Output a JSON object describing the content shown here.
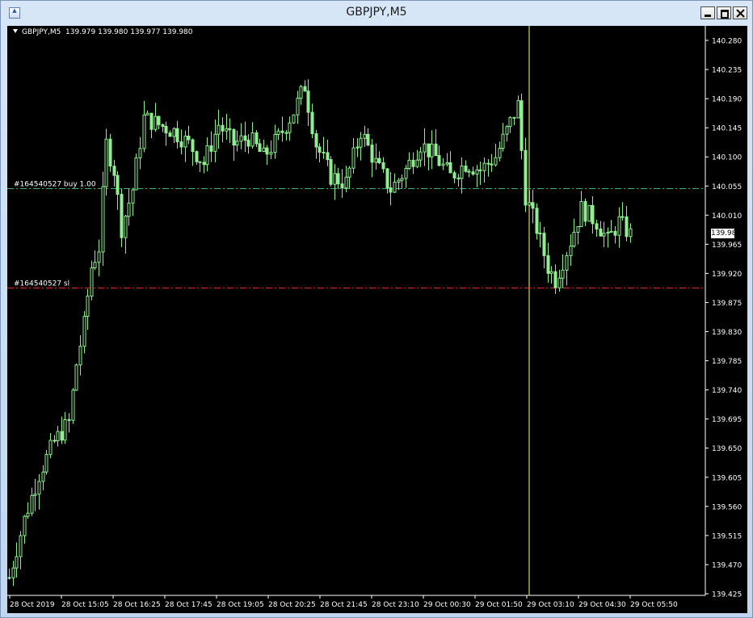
{
  "window": {
    "title": "GBPJPY,M5",
    "icon": "chart-window-icon",
    "controls": [
      "minimize",
      "maximize",
      "close"
    ]
  },
  "colors": {
    "background": "#000000",
    "candle": "#90ee90",
    "buy_line": "#3cb371",
    "sl_line": "#ff2020",
    "cursor_line": "#ffff60",
    "axis": "#ffffff"
  },
  "chart_info": {
    "symbol": "GBPJPY,M5",
    "ohlc": "139.979 139.980 139.977 139.980"
  },
  "current_price": "139.980",
  "order_lines": [
    {
      "label": "#164540527 buy 1.00",
      "price": 140.052,
      "style": "dash-dot",
      "color": "#3cb371"
    },
    {
      "label": "#164540527 sl",
      "price": 139.898,
      "style": "dash-dot",
      "color": "#ff2020"
    }
  ],
  "chart_data": {
    "type": "candlestick",
    "y_ticks": [
      "140.280",
      "140.235",
      "140.190",
      "140.145",
      "140.100",
      "140.055",
      "140.010",
      "139.965",
      "139.920",
      "139.875",
      "139.830",
      "139.785",
      "139.740",
      "139.695",
      "139.650",
      "139.605",
      "139.560",
      "139.515",
      "139.470",
      "139.425"
    ],
    "ylim": [
      139.425,
      140.28
    ],
    "x_ticks": [
      "28 Oct 2019",
      "28 Oct 15:05",
      "28 Oct 16:25",
      "28 Oct 17:45",
      "28 Oct 19:05",
      "28 Oct 20:25",
      "28 Oct 21:45",
      "28 Oct 23:10",
      "29 Oct 00:30",
      "29 Oct 01:50",
      "29 Oct 03:10",
      "29 Oct 04:30",
      "29 Oct 05:50"
    ],
    "cursor_after_label_index": 10,
    "series_shape": [
      [
        0,
        139.45
      ],
      [
        4,
        139.54
      ],
      [
        8,
        139.61
      ],
      [
        12,
        139.66
      ],
      [
        16,
        139.69
      ],
      [
        18,
        139.78
      ],
      [
        20,
        139.84
      ],
      [
        22,
        139.93
      ],
      [
        24,
        139.96
      ],
      [
        26,
        140.12
      ],
      [
        28,
        140.08
      ],
      [
        30,
        139.99
      ],
      [
        33,
        140.05
      ],
      [
        36,
        140.16
      ],
      [
        40,
        140.15
      ],
      [
        44,
        140.14
      ],
      [
        48,
        140.12
      ],
      [
        52,
        140.09
      ],
      [
        56,
        140.15
      ],
      [
        60,
        140.12
      ],
      [
        64,
        140.13
      ],
      [
        68,
        140.1
      ],
      [
        72,
        140.13
      ],
      [
        76,
        140.17
      ],
      [
        79,
        140.21
      ],
      [
        82,
        140.12
      ],
      [
        86,
        140.07
      ],
      [
        90,
        140.06
      ],
      [
        94,
        140.14
      ],
      [
        98,
        140.09
      ],
      [
        102,
        140.05
      ],
      [
        106,
        140.08
      ],
      [
        110,
        140.12
      ],
      [
        114,
        140.1
      ],
      [
        118,
        140.07
      ],
      [
        122,
        140.09
      ],
      [
        126,
        140.08
      ],
      [
        130,
        140.1
      ],
      [
        133,
        140.14
      ],
      [
        136,
        140.18
      ],
      [
        138,
        140.04
      ],
      [
        141,
        139.99
      ],
      [
        144,
        139.93
      ],
      [
        146,
        139.91
      ],
      [
        150,
        139.97
      ],
      [
        153,
        140.02
      ],
      [
        157,
        140.0
      ],
      [
        160,
        139.97
      ],
      [
        163,
        140.0
      ],
      [
        166,
        139.98
      ]
    ]
  }
}
